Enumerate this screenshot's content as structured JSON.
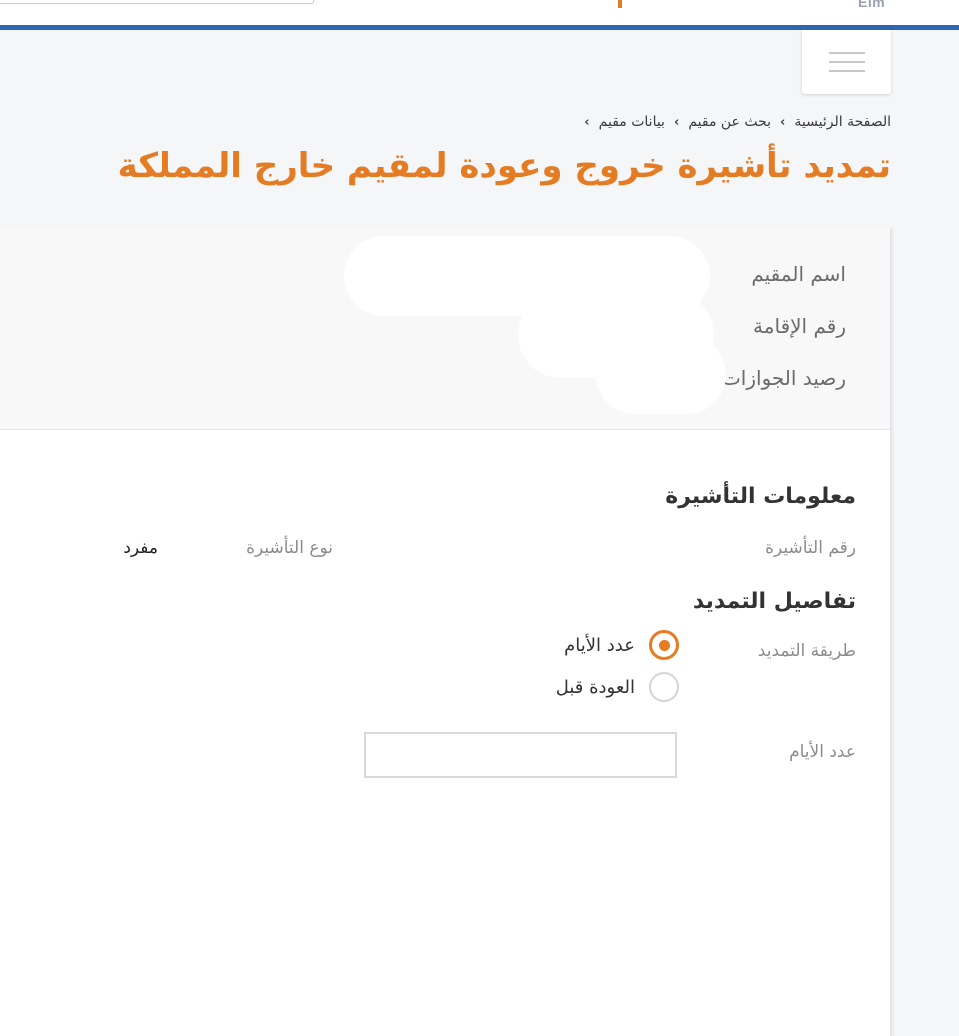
{
  "header": {
    "logo_text": "Elm"
  },
  "breadcrumb": [
    {
      "label": "الصفحة الرئيسية"
    },
    {
      "label": "بحث عن مقيم"
    },
    {
      "label": "بيانات مقيم"
    }
  ],
  "breadcrumb_separator": "›",
  "page_title": "تمديد تأشيرة خروج وعودة لمقيم خارج المملكة",
  "resident_info": {
    "name_label": "اسم المقيم",
    "iqama_label": "رقم الإقامة",
    "balance_label": "رصيد الجوازات"
  },
  "visa_info": {
    "section_title": "معلومات التأشيرة",
    "visa_number_label": "رقم التأشيرة",
    "visa_type_label": "نوع التأشيرة",
    "visa_type_value": "مفرد"
  },
  "extension": {
    "section_title": "تفاصيل التمديد",
    "method_label": "طريقة التمديد",
    "options": [
      {
        "label": "عدد الأيام",
        "selected": true
      },
      {
        "label": "العودة قبل",
        "selected": false
      }
    ],
    "days_label": "عدد الأيام",
    "days_value": ""
  },
  "colors": {
    "accent": "#e57b22",
    "brand_bar": "#2f66b3"
  }
}
